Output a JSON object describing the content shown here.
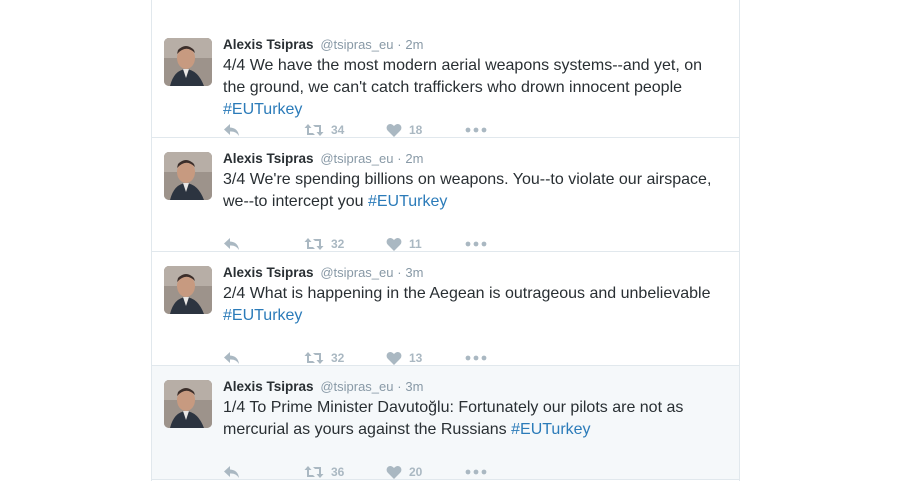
{
  "tweets": [
    {
      "name": "Alexis Tsipras",
      "handle": "@tsipras_eu",
      "separator": "·",
      "time": "2m",
      "text": "4/4 We have the most modern aerial weapons systems--and yet, on the ground, we can't catch traffickers who drown innocent people ",
      "hashtag": "#EUTurkey",
      "retweets": "34",
      "likes": "18",
      "highlighted": false
    },
    {
      "name": "Alexis Tsipras",
      "handle": "@tsipras_eu",
      "separator": "·",
      "time": "2m",
      "text": "3/4 We're spending billions on weapons. You--to violate our airspace, we--to intercept you ",
      "hashtag": "#EUTurkey",
      "retweets": "32",
      "likes": "11",
      "highlighted": false
    },
    {
      "name": "Alexis Tsipras",
      "handle": "@tsipras_eu",
      "separator": "·",
      "time": "3m",
      "text": "2/4 What is happening in the Aegean is outrageous and unbelievable ",
      "hashtag": "#EUTurkey",
      "retweets": "32",
      "likes": "13",
      "highlighted": false
    },
    {
      "name": "Alexis Tsipras",
      "handle": "@tsipras_eu",
      "separator": "·",
      "time": "3m",
      "text": "1/4 To Prime Minister Davutoğlu: Fortunately our pilots are not as mercurial as yours against the Russians ",
      "hashtag": "#EUTurkey",
      "retweets": "36",
      "likes": "20",
      "highlighted": true
    }
  ],
  "icons": {
    "reply": "reply-icon",
    "retweet": "retweet-icon",
    "like": "heart-icon",
    "more": "more-dots-icon"
  },
  "colors": {
    "hashtag": "#2b7bb9",
    "action_icon": "#aab8c2",
    "highlight_bg": "#f5f8fa"
  }
}
